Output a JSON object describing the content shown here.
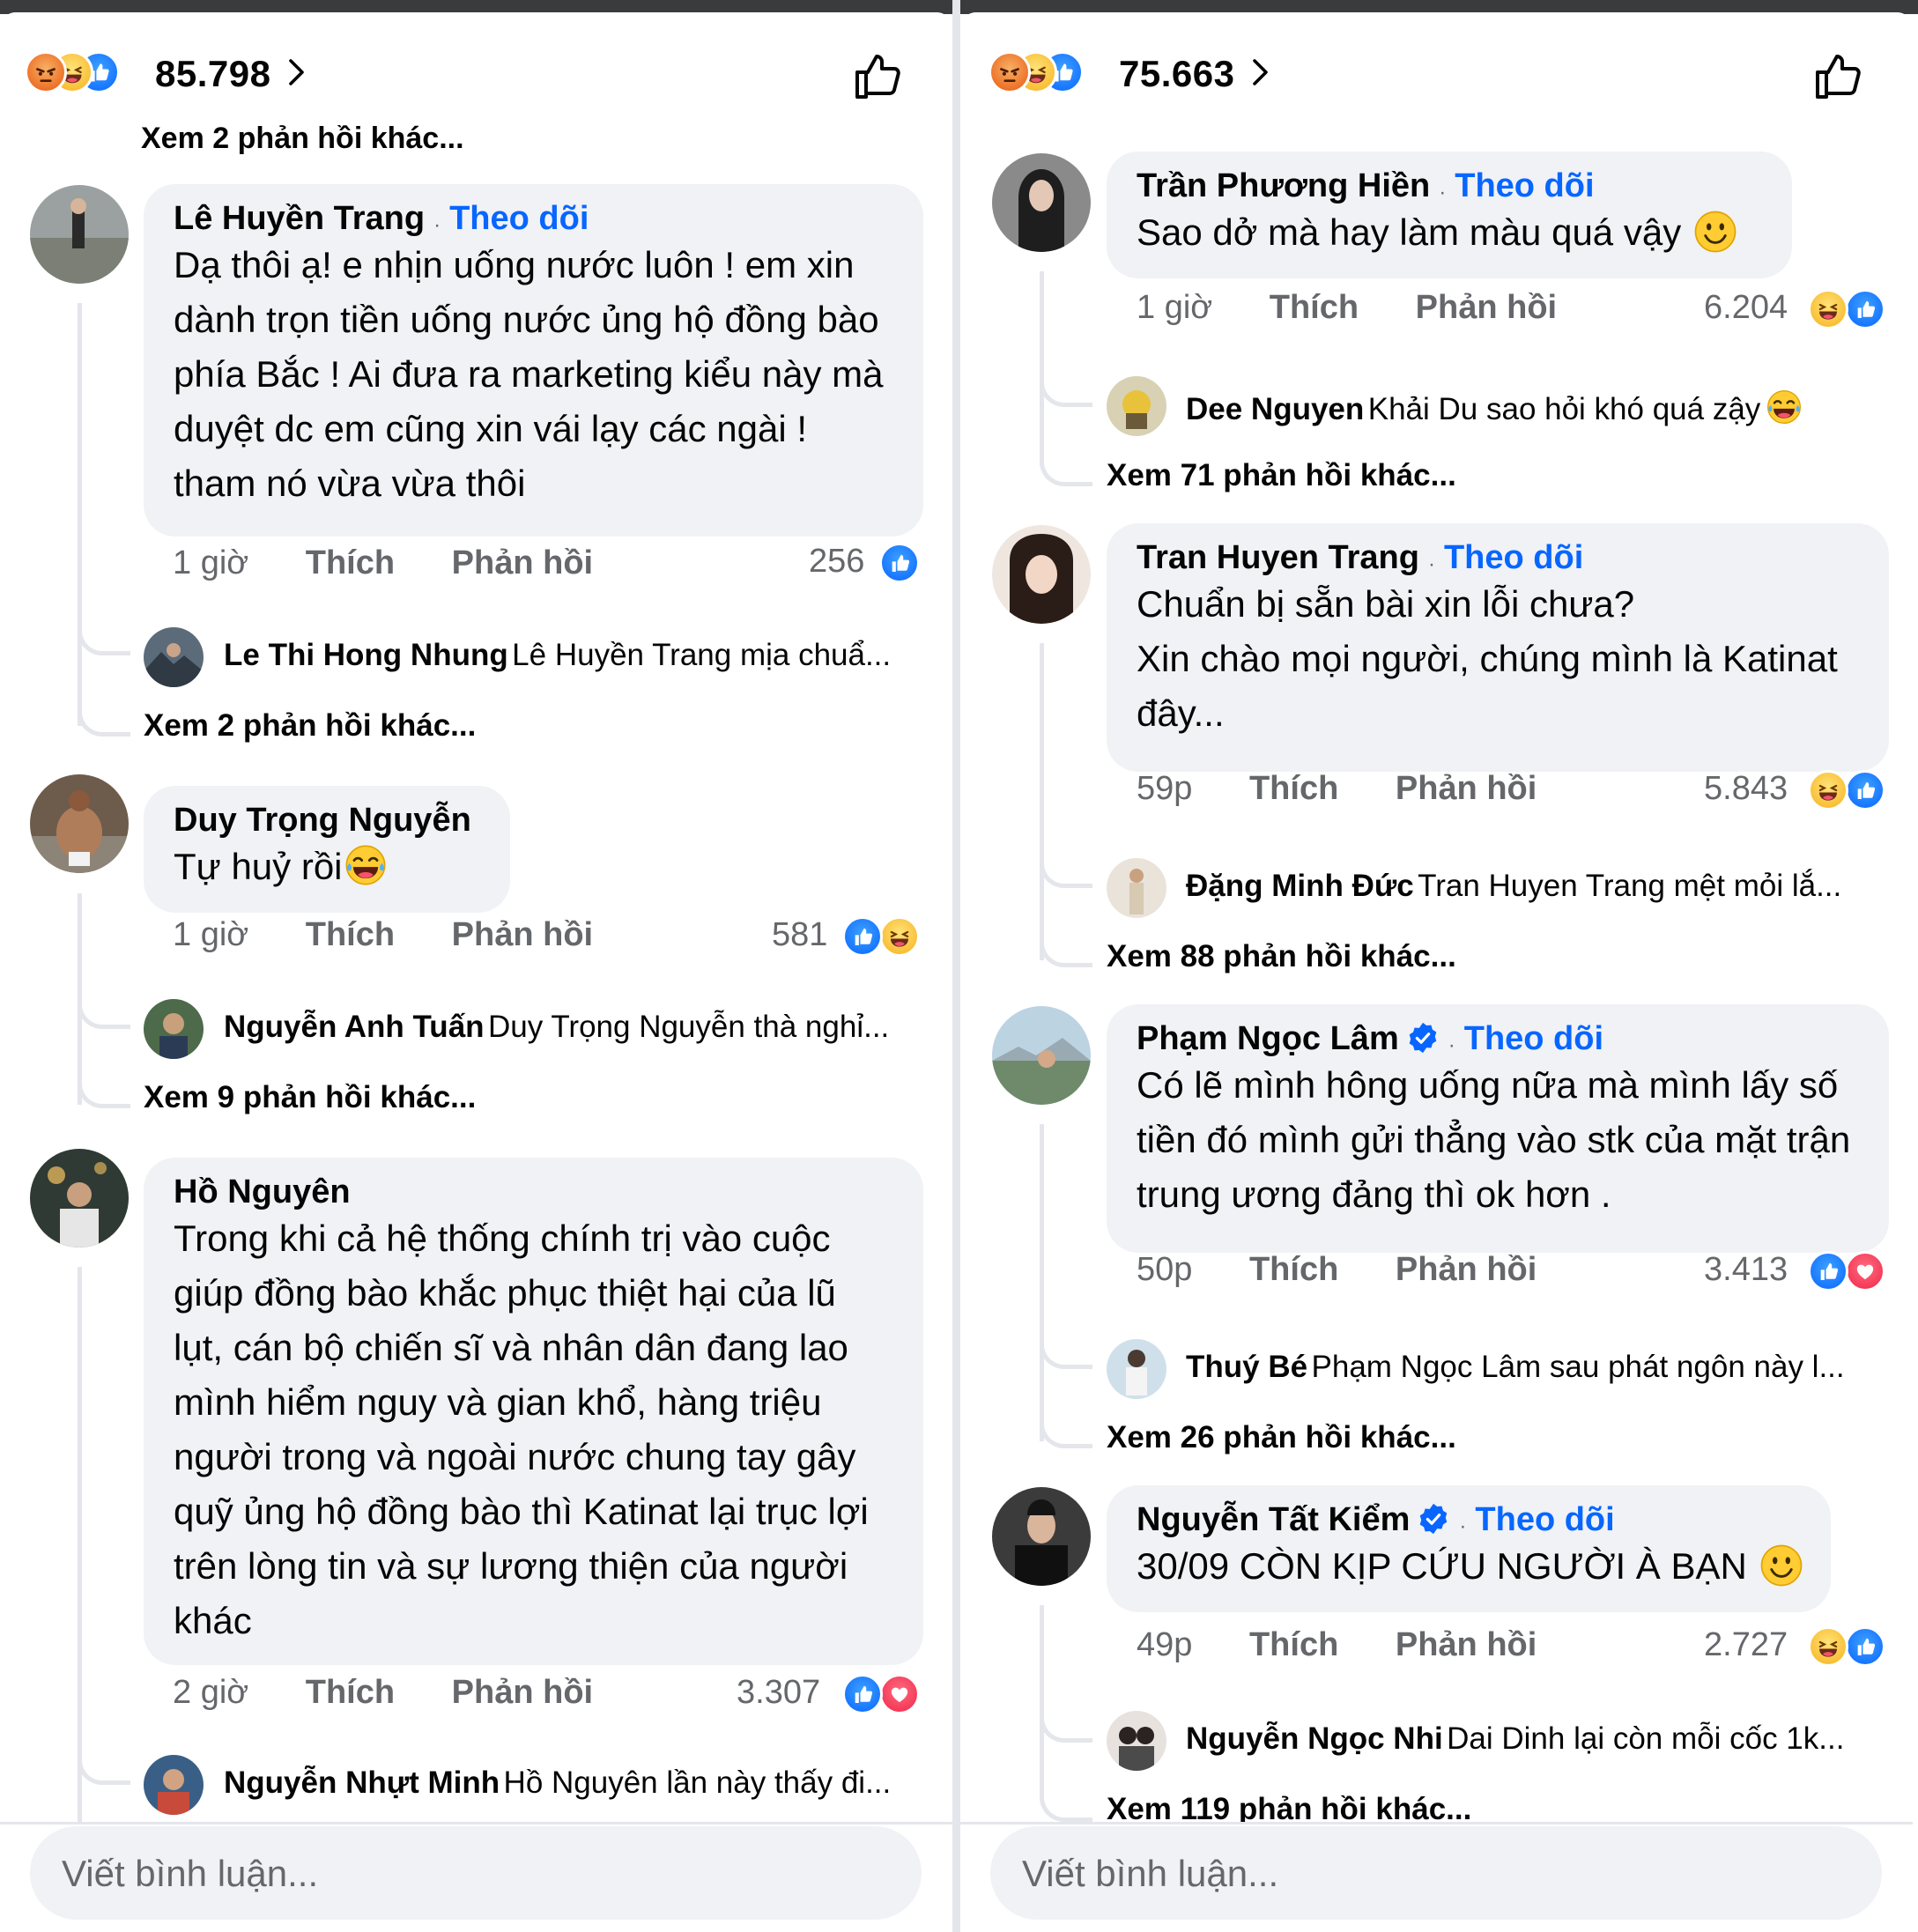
{
  "left": {
    "reaction_total": "85.798",
    "scroll_partial": "Xem 2 phản hồi khác...",
    "composer_placeholder": "Viết bình luận...",
    "comments": [
      {
        "name": "Lê Huyền Trang",
        "follow": "Theo dõi",
        "text": "Dạ thôi ạ! e nhịn uống nước luôn ! em xin dành trọn tiền uống nước ủng hộ đồng bào phía Bắc ! Ai đưa ra marketing kiểu này mà duyệt dc em cũng xin vái lạy các ngài ! tham nó vừa vừa thôi",
        "time": "1 giờ",
        "like": "Thích",
        "reply": "Phản hồi",
        "reaction_count": "256",
        "reply_name": "Le Thi Hong Nhung",
        "reply_text": "Lê Huyền Trang mịa chuẩ...",
        "more": "Xem 2 phản hồi khác..."
      },
      {
        "name": "Duy Trọng Nguyễn",
        "text": "Tự huỷ rồi",
        "time": "1 giờ",
        "like": "Thích",
        "reply": "Phản hồi",
        "reaction_count": "581",
        "reply_name": "Nguyễn Anh Tuấn",
        "reply_text": "Duy Trọng Nguyễn thà nghỉ...",
        "more": "Xem 9 phản hồi khác..."
      },
      {
        "name": "Hồ Nguyên",
        "text": "Trong khi cả hệ thống chính trị vào cuộc giúp đồng bào khắc phục thiệt hại của lũ lụt, cán bộ chiến sĩ và nhân dân đang lao mình hiểm nguy và gian khổ, hàng triệu người trong và ngoài nước chung tay gây quỹ ủng hộ đồng bào thì Katinat lại trục lợi trên lòng tin và sự lương thiện của người khác",
        "time": "2 giờ",
        "like": "Thích",
        "reply": "Phản hồi",
        "reaction_count": "3.307",
        "reply_name": "Nguyễn Nhựt Minh",
        "reply_text": "Hồ Nguyên lần này thấy đi..."
      }
    ]
  },
  "right": {
    "reaction_total": "75.663",
    "composer_placeholder": "Viết bình luận...",
    "comments": [
      {
        "name": "Trần Phương Hiền",
        "follow": "Theo dõi",
        "text": "Sao dở mà hay làm màu quá vậy",
        "time": "1 giờ",
        "like": "Thích",
        "reply": "Phản hồi",
        "reaction_count": "6.204",
        "reply_name": "Dee Nguyen",
        "reply_text": "Khải Du sao hỏi khó quá zậy",
        "more": "Xem 71 phản hồi khác..."
      },
      {
        "name": "Tran Huyen Trang",
        "follow": "Theo dõi",
        "text_lines": [
          "Chuẩn bị sẵn bài xin lỗi chưa?",
          "Xin chào mọi người, chúng mình là Katinat đây..."
        ],
        "time": "59p",
        "like": "Thích",
        "reply": "Phản hồi",
        "reaction_count": "5.843",
        "reply_name": "Đặng Minh Đức",
        "reply_text": "Tran Huyen Trang mệt mỏi lắ...",
        "more": "Xem 88 phản hồi khác..."
      },
      {
        "name": "Phạm Ngọc Lâm",
        "follow": "Theo dõi",
        "text": "Có lẽ mình hông uống nữa mà mình lấy số tiền đó mình gửi thẳng vào stk của mặt trận trung ương đảng thì ok hơn .",
        "time": "50p",
        "like": "Thích",
        "reply": "Phản hồi",
        "reaction_count": "3.413",
        "reply_name": "Thuý Bé",
        "reply_text": "Phạm Ngọc Lâm sau phát ngôn này l...",
        "more": "Xem 26 phản hồi khác..."
      },
      {
        "name": "Nguyễn Tất Kiểm",
        "follow": "Theo dõi",
        "text": "30/09 CÒN KỊP CỨU NGƯỜI À BẠN",
        "time": "49p",
        "like": "Thích",
        "reply": "Phản hồi",
        "reaction_count": "2.727",
        "reply_name": "Nguyễn Ngọc Nhi",
        "reply_text": "Dai Dinh lại còn mỗi cốc 1k...",
        "more": "Xem 119 phản hồi khác..."
      }
    ]
  },
  "colors": {
    "link_blue": "#0866ff",
    "bubble": "#f0f2f5",
    "meta_gray": "#65676b",
    "like_blue": "#0866ff",
    "love_red": "#f02849"
  },
  "icons": [
    "angry-reaction-icon",
    "haha-reaction-icon",
    "like-reaction-icon",
    "love-reaction-icon",
    "chevron-right-icon",
    "thumbs-up-outline-icon",
    "verified-badge-icon",
    "smile-emoji-icon",
    "laughing-emoji-icon"
  ]
}
